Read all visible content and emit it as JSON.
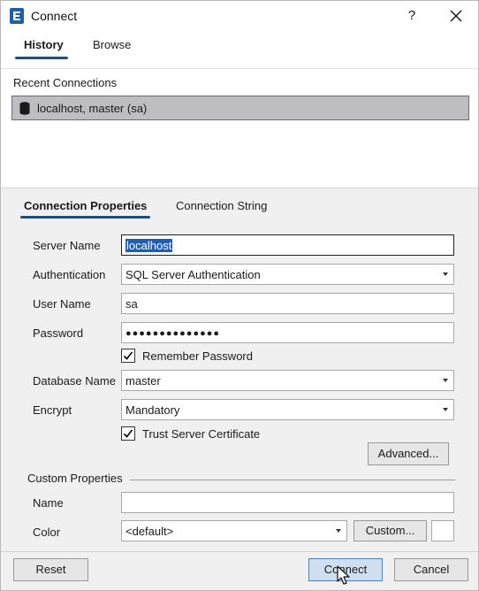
{
  "window": {
    "title": "Connect",
    "help_label": "?",
    "icons": {
      "app": "app-logo-icon",
      "close": "close-icon"
    }
  },
  "top_tabs": [
    {
      "label": "History",
      "selected": true
    },
    {
      "label": "Browse",
      "selected": false
    }
  ],
  "recent": {
    "label": "Recent Connections",
    "items": [
      {
        "label": "localhost, master (sa)",
        "icon": "database-icon",
        "selected": true
      }
    ]
  },
  "conn_tabs": [
    {
      "label": "Connection Properties",
      "selected": true
    },
    {
      "label": "Connection String",
      "selected": false
    }
  ],
  "form": {
    "server_name": {
      "label": "Server Name",
      "value": "localhost"
    },
    "authentication": {
      "label": "Authentication",
      "value": "SQL Server Authentication"
    },
    "user_name": {
      "label": "User Name",
      "value": "sa"
    },
    "password": {
      "label": "Password",
      "value": "●●●●●●●●●●●●●●"
    },
    "remember_password": {
      "label": "Remember Password",
      "checked": true
    },
    "database_name": {
      "label": "Database Name",
      "value": "master"
    },
    "encrypt": {
      "label": "Encrypt",
      "value": "Mandatory"
    },
    "trust_server_certificate": {
      "label": "Trust Server Certificate",
      "checked": true
    },
    "advanced_label": "Advanced...",
    "custom_properties": {
      "title": "Custom Properties",
      "name": {
        "label": "Name",
        "value": ""
      },
      "color": {
        "label": "Color",
        "value": "<default>"
      },
      "custom_label": "Custom..."
    }
  },
  "footer": {
    "reset_label": "Reset",
    "connect_label": "Connect",
    "cancel_label": "Cancel"
  },
  "colors": {
    "accent": "#1f4e79",
    "selection": "#1e5fb4",
    "recent_item_bg": "#bdbdc2",
    "primary_button_bg": "#cfdff0"
  }
}
